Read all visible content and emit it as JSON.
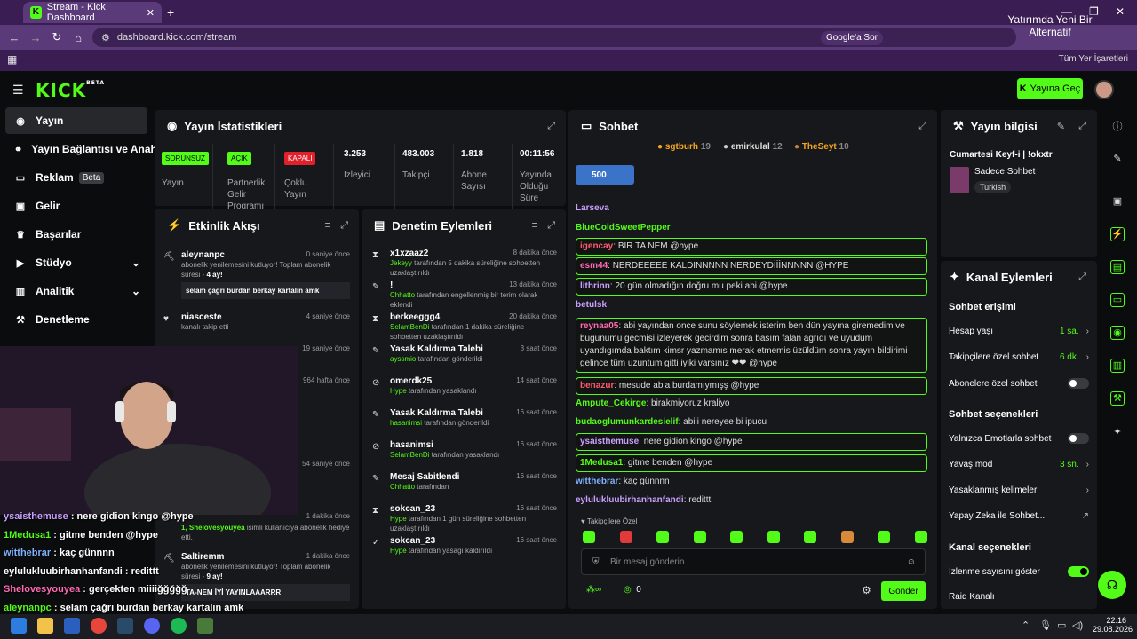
{
  "browser": {
    "tab_title": "Stream - Kick Dashboard",
    "url": "dashboard.kick.com/stream",
    "google_search": "Google'a Sor",
    "notification": "Yatırımda Yeni Bir Alternatif",
    "bookmarks_label": "Tüm Yer İşaretleri"
  },
  "header": {
    "logo": "KICK",
    "logo_beta": "BETA",
    "go_live": "Yayına Geç"
  },
  "sidebar": {
    "items": [
      {
        "label": "Yayın",
        "icon": "broadcast-icon"
      },
      {
        "label": "Yayın Bağlantısı ve Anahtarı",
        "icon": "link-icon"
      },
      {
        "label": "Reklam",
        "beta": "Beta",
        "icon": "ad-icon"
      },
      {
        "label": "Gelir",
        "icon": "money-icon"
      },
      {
        "label": "Başarılar",
        "icon": "trophy-icon"
      },
      {
        "label": "Stüdyo",
        "icon": "studio-icon"
      },
      {
        "label": "Analitik",
        "icon": "analytics-icon"
      },
      {
        "label": "Denetleme",
        "icon": "hammer-icon"
      }
    ]
  },
  "stats": {
    "title": "Yayın İstatistikleri",
    "items": [
      {
        "badge": "SORUNSUZ",
        "label": "Yayın",
        "color": "#53fc18"
      },
      {
        "badge": "AÇIK",
        "label": "Partnerlik Gelir Programı",
        "color": "#53fc18"
      },
      {
        "badge": "KAPALI",
        "label": "Çoklu Yayın",
        "color": "#e0202a"
      },
      {
        "value": "3.253",
        "label": "İzleyici"
      },
      {
        "value": "483.003",
        "label": "Takipçi"
      },
      {
        "value": "1.818",
        "label": "Abone Sayısı"
      },
      {
        "value": "00:11:56",
        "label": "Yayında Olduğu Süre"
      }
    ]
  },
  "activity": {
    "title": "Etkinlik Akışı",
    "items": [
      {
        "name": "aleynanpc",
        "time": "0 saniye önce",
        "desc": "abonelik yenilemesini kutluyor! Toplam abonelik süresi - ",
        "months": "4 ay!",
        "msg": "selam çağrı burdan berkay kartalın amk"
      },
      {
        "name": "niasceste",
        "time": "4 saniye önce",
        "desc": "kanalı takip etti"
      },
      {
        "time": "19 saniye önce"
      },
      {
        "time": "964 hafta önce"
      },
      {
        "time": "54 saniye önce"
      },
      {
        "time": "1 dakika önce",
        "desc": "isimli kullanıcıya abonelik hediye etti.",
        "gift_user": "1, Shelovesyouyea"
      },
      {
        "name": "Saltiremm",
        "time": "1 dakika önce",
        "desc": "abonelik yenilemesini kutluyor! Toplam abonelik süresi - ",
        "months": "9 ay!",
        "msg": "TA-NEM İYİ YAYINLAAARRR"
      }
    ]
  },
  "moderation": {
    "title": "Denetim Eylemleri",
    "items": [
      {
        "name": "x1xzaaz2",
        "time": "8 dakika önce",
        "actor": "Jekeyy",
        "desc": "tarafından 5 dakika süreliğine sohbetten uzaklaştırıldı"
      },
      {
        "name": "!",
        "time": "13 dakika önce",
        "actor": "Chhatto",
        "desc": "tarafından engellenmiş bir terim olarak eklendi"
      },
      {
        "name": "berkeeggg4",
        "time": "20 dakika önce",
        "actor": "SelamBenDi",
        "desc": "tarafından 1 dakika süreliğine sohbetten uzaklaştırıldı"
      },
      {
        "name": "Yasak Kaldırma Talebi",
        "time": "3 saat önce",
        "actor": "ayssmio",
        "desc": "tarafından gönderildi"
      },
      {
        "name": "omerdk25",
        "time": "14 saat önce",
        "actor": "Hype",
        "desc": "tarafından yasaklandı"
      },
      {
        "name": "Yasak Kaldırma Talebi",
        "time": "16 saat önce",
        "actor": "hasanimsi",
        "desc": "tarafından gönderildi"
      },
      {
        "name": "hasanimsi",
        "time": "16 saat önce",
        "actor": "SelamBenDi",
        "desc": "tarafından yasaklandı"
      },
      {
        "name": "Mesaj Sabitlendi",
        "time": "16 saat önce",
        "actor": "Chhatto",
        "desc": "tarafından"
      },
      {
        "name": "sokcan_23",
        "time": "16 saat önce",
        "actor": "Hype",
        "desc": "tarafından 1 gün süreliğine sohbetten uzaklaştırıldı"
      },
      {
        "name": "sokcan_23",
        "time": "16 saat önce",
        "actor": "Hype",
        "desc": "tarafından yasağı kaldırıldı"
      }
    ]
  },
  "chat": {
    "title": "Sohbet",
    "top": [
      {
        "rank": "1",
        "name": "sgtburh",
        "count": "19"
      },
      {
        "rank": "2",
        "name": "emirkulal",
        "count": "12"
      },
      {
        "rank": "3",
        "name": "TheSeyt",
        "count": "10"
      }
    ],
    "pinned": "500",
    "messages": [
      {
        "name": "Larseva",
        "color": "#c9a0ff",
        "text": ""
      },
      {
        "name": "BlueColdSweetPepper",
        "color": "#53fc18",
        "text": ""
      },
      {
        "name": "igencay",
        "color": "#ff5a6e",
        "text": "BİR TA NEM @hype",
        "box": true
      },
      {
        "name": "esm44",
        "color": "#ff6ab0",
        "text": "NERDEEEEE KALDINNNNN NERDEYDİİİNNNNN @HYPE",
        "box": true
      },
      {
        "name": "lithrinn",
        "color": "#c9a0ff",
        "text": "20 gün olmadığın doğru mu peki abi @hype",
        "box": true
      },
      {
        "name": "betulsk",
        "color": "#c9a0ff",
        "text": ""
      },
      {
        "name": "reynaa05",
        "color": "#ff6ab0",
        "text": "abi yayından once sunu söylemek isterim ben dün yayına giremedim ve bugunumu gecmisi izleyerek gecirdim sonra basım falan agrıdı ve uyudum uyandıgımda baktım kimsr yazmamıs merak etmemis üzüldüm sonra yayın bildirimi gelince tüm uzuntum gitti iyiki varsınız ❤❤ @hype",
        "box": true
      },
      {
        "name": "benazur",
        "color": "#ff5a6e",
        "text": "mesude abla burdamıymışş @hype",
        "box": true
      },
      {
        "name": "Ampute_Cekirge",
        "color": "#53fc18",
        "text": "birakmiyoruz kraliyo"
      },
      {
        "name": "budaoglumunkardesielif",
        "color": "#53fc18",
        "text": "abiii nereyee bi ipucu"
      },
      {
        "name": "ysaisthemuse",
        "color": "#c9a0ff",
        "text": "nere gidion kingo @hype",
        "box": true
      },
      {
        "name": "1Medusa1",
        "color": "#53fc18",
        "text": "gitme benden @hype",
        "box": true
      },
      {
        "name": "witthebrar",
        "color": "#7fb2ff",
        "text": "kaç günnnn"
      },
      {
        "name": "eylulukluubirhanhanfandi",
        "color": "#c9a0ff",
        "text": "redittt"
      }
    ],
    "followers_only": "Takipçilere Özel",
    "placeholder": "Bir mesaj gönderin",
    "points": "0",
    "send": "Gönder"
  },
  "stream_info": {
    "title": "Yayın bilgisi",
    "stream_title": "Cumartesi Keyf-i | !okxtr",
    "category": "Sadece Sohbet",
    "tag": "Turkish"
  },
  "channel": {
    "title": "Kanal Eylemleri",
    "chat_access": "Sohbet erişimi",
    "account_age": "Hesap yaşı",
    "account_age_val": "1 sa.",
    "followers_only": "Takipçilere özel sohbet",
    "followers_only_val": "6 dk.",
    "subs_only": "Abonelere özel sohbet",
    "chat_options": "Sohbet seçenekleri",
    "emotes_only": "Yalnızca Emotlarla sohbet",
    "slow_mode": "Yavaş mod",
    "slow_mode_val": "3 sn.",
    "banned_words": "Yasaklanmış kelimeler",
    "ai_chat": "Yapay Zeka ile Sohbet...",
    "channel_options": "Kanal seçenekleri",
    "show_viewers": "İzlenme sayısını göster",
    "raid": "Raid Kanalı"
  },
  "overlay_chat": [
    {
      "name": "ysaisthemuse",
      "color": "#c9a0ff",
      "text": "nere gidion kingo @hype"
    },
    {
      "name": "1Medusa1",
      "color": "#53fc18",
      "text": "gitme benden @hype"
    },
    {
      "name": "witthebrar",
      "color": "#7fb2ff",
      "text": "kaç günnnn"
    },
    {
      "name": "eylulukluubirhanhanfandi",
      "color": "#ffffff",
      "text": "redittt"
    },
    {
      "name": "Shelovesyouyea",
      "color": "#ff6ab0",
      "text": "gerçekten miiiiğğğğğ"
    },
    {
      "name": "aleynanpc",
      "color": "#53fc18",
      "text": "selam çağrı burdan berkay kartalın amk"
    }
  ],
  "taskbar": {
    "time": "22:16",
    "date": "29.08.2026"
  }
}
